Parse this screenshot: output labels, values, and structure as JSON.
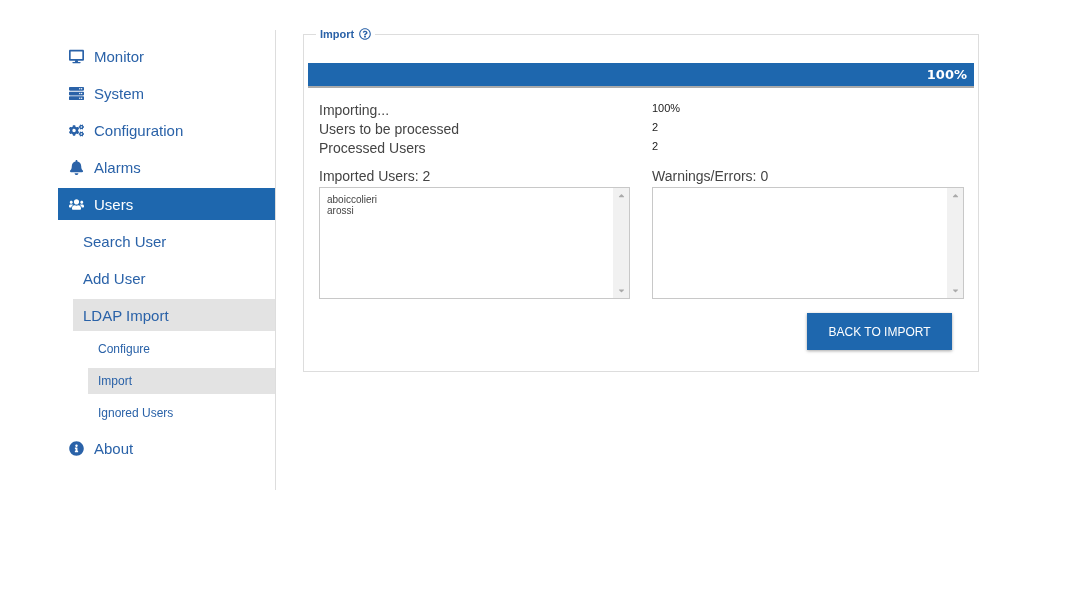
{
  "sidebar": {
    "items": [
      {
        "label": "Monitor",
        "selected": false
      },
      {
        "label": "System",
        "selected": false
      },
      {
        "label": "Configuration",
        "selected": false
      },
      {
        "label": "Alarms",
        "selected": false
      },
      {
        "label": "Users",
        "selected": true,
        "children": [
          {
            "label": "Search User",
            "selected": false
          },
          {
            "label": "Add User",
            "selected": false
          },
          {
            "label": "LDAP Import",
            "selected": true,
            "children": [
              {
                "label": "Configure",
                "selected": false
              },
              {
                "label": "Import",
                "selected": true
              },
              {
                "label": "Ignored Users",
                "selected": false
              }
            ]
          }
        ]
      },
      {
        "label": "About",
        "selected": false
      }
    ]
  },
  "panel": {
    "title": "Import",
    "progress": {
      "level": 1,
      "reading": "100%"
    },
    "stats": [
      {
        "label": "Importing...",
        "value": "100%"
      },
      {
        "label": "Users to be processed",
        "value": "2"
      },
      {
        "label": "Processed Users",
        "value": "2"
      }
    ],
    "lists": [
      {
        "label": "Imported Users: 2",
        "lines": [
          "aboiccolieri",
          "arossi"
        ]
      },
      {
        "label": "Warnings/Errors: 0"
      }
    ],
    "button": "BACK TO IMPORT"
  }
}
